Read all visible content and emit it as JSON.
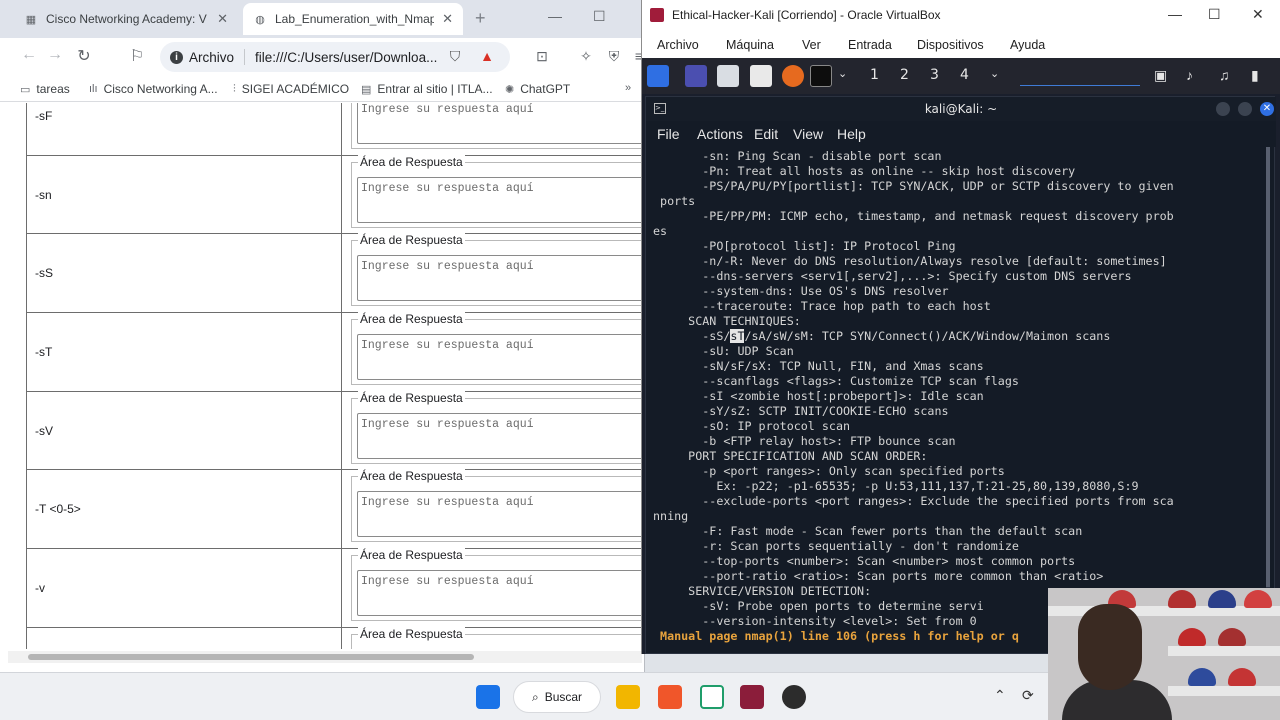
{
  "browser": {
    "tabs": [
      {
        "title": "Cisco Networking Academy: V Hack",
        "active": false
      },
      {
        "title": "Lab_Enumeration_with_Nmap.h",
        "active": true
      }
    ],
    "address": {
      "scheme_label": "Archivo",
      "url": "file:///C:/Users/user/Downloa..."
    },
    "bookmarks": [
      "tareas",
      "Cisco Networking A...",
      "SIGEI ACADÉMICO",
      "Entrar al sitio | ITLA...",
      "ChatGPT"
    ],
    "form": {
      "legend": "Área de Respuesta",
      "placeholder": "Ingrese su respuesta aquí",
      "rows": [
        {
          "option": "-sF",
          "show_legend": false
        },
        {
          "option": "-sn",
          "show_legend": true
        },
        {
          "option": "-sS",
          "show_legend": true
        },
        {
          "option": "-sT",
          "show_legend": true
        },
        {
          "option": "-sV",
          "show_legend": true
        },
        {
          "option": "-T <0-5>",
          "show_legend": true
        },
        {
          "option": "-v",
          "show_legend": true
        },
        {
          "option": "",
          "show_legend": true
        }
      ]
    }
  },
  "vbox": {
    "title": "Ethical-Hacker-Kali [Corriendo] - Oracle VirtualBox",
    "menu": [
      "Archivo",
      "Máquina",
      "Ver",
      "Entrada",
      "Dispositivos",
      "Ayuda"
    ],
    "workspaces": [
      "1",
      "2",
      "3",
      "4"
    ]
  },
  "terminal": {
    "title": "kali@Kali: ~",
    "menu": [
      "File",
      "Actions",
      "Edit",
      "View",
      "Help"
    ],
    "lines": [
      "       -sn: Ping Scan - disable port scan",
      "       -Pn: Treat all hosts as online -- skip host discovery",
      "       -PS/PA/PU/PY[portlist]: TCP SYN/ACK, UDP or SCTP discovery to given",
      "",
      " ports",
      "",
      "       -PE/PP/PM: ICMP echo, timestamp, and netmask request discovery prob",
      "",
      "es",
      "",
      "       -PO[protocol list]: IP Protocol Ping",
      "       -n/-R: Never do DNS resolution/Always resolve [default: sometimes]",
      "       --dns-servers <serv1[,serv2],...>: Specify custom DNS servers",
      "       --system-dns: Use OS's DNS resolver",
      "       --traceroute: Trace hop path to each host",
      "     SCAN TECHNIQUES:",
      "       -sS/sT/sA/sW/sM: TCP SYN/Connect()/ACK/Window/Maimon scans",
      "       -sU: UDP Scan",
      "       -sN/sF/sX: TCP Null, FIN, and Xmas scans",
      "       --scanflags <flags>: Customize TCP scan flags",
      "       -sI <zombie host[:probeport]>: Idle scan",
      "       -sY/sZ: SCTP INIT/COOKIE-ECHO scans",
      "       -sO: IP protocol scan",
      "       -b <FTP relay host>: FTP bounce scan",
      "     PORT SPECIFICATION AND SCAN ORDER:",
      "       -p <port ranges>: Only scan specified ports",
      "         Ex: -p22; -p1-65535; -p U:53,111,137,T:21-25,80,139,8080,S:9",
      "       --exclude-ports <port ranges>: Exclude the specified ports from sca",
      "",
      "nning",
      "",
      "       -F: Fast mode - Scan fewer ports than the default scan",
      "       -r: Scan ports sequentially - don't randomize",
      "       --top-ports <number>: Scan <number> most common ports",
      "       --port-ratio <ratio>: Scan ports more common than <ratio>",
      "     SERVICE/VERSION DETECTION:",
      "       -sV: Probe open ports to determine servi",
      "       --version-intensity <level>: Set from 0"
    ],
    "status_line": " Manual page nmap(1) line 106 (press h for help or q"
  },
  "taskbar": {
    "search_label": "Buscar"
  },
  "colors": {
    "term_bg": "#141b26",
    "term_fg": "#d4d4d4",
    "status": "#e8a33d",
    "accent": "#2f6fe3"
  }
}
